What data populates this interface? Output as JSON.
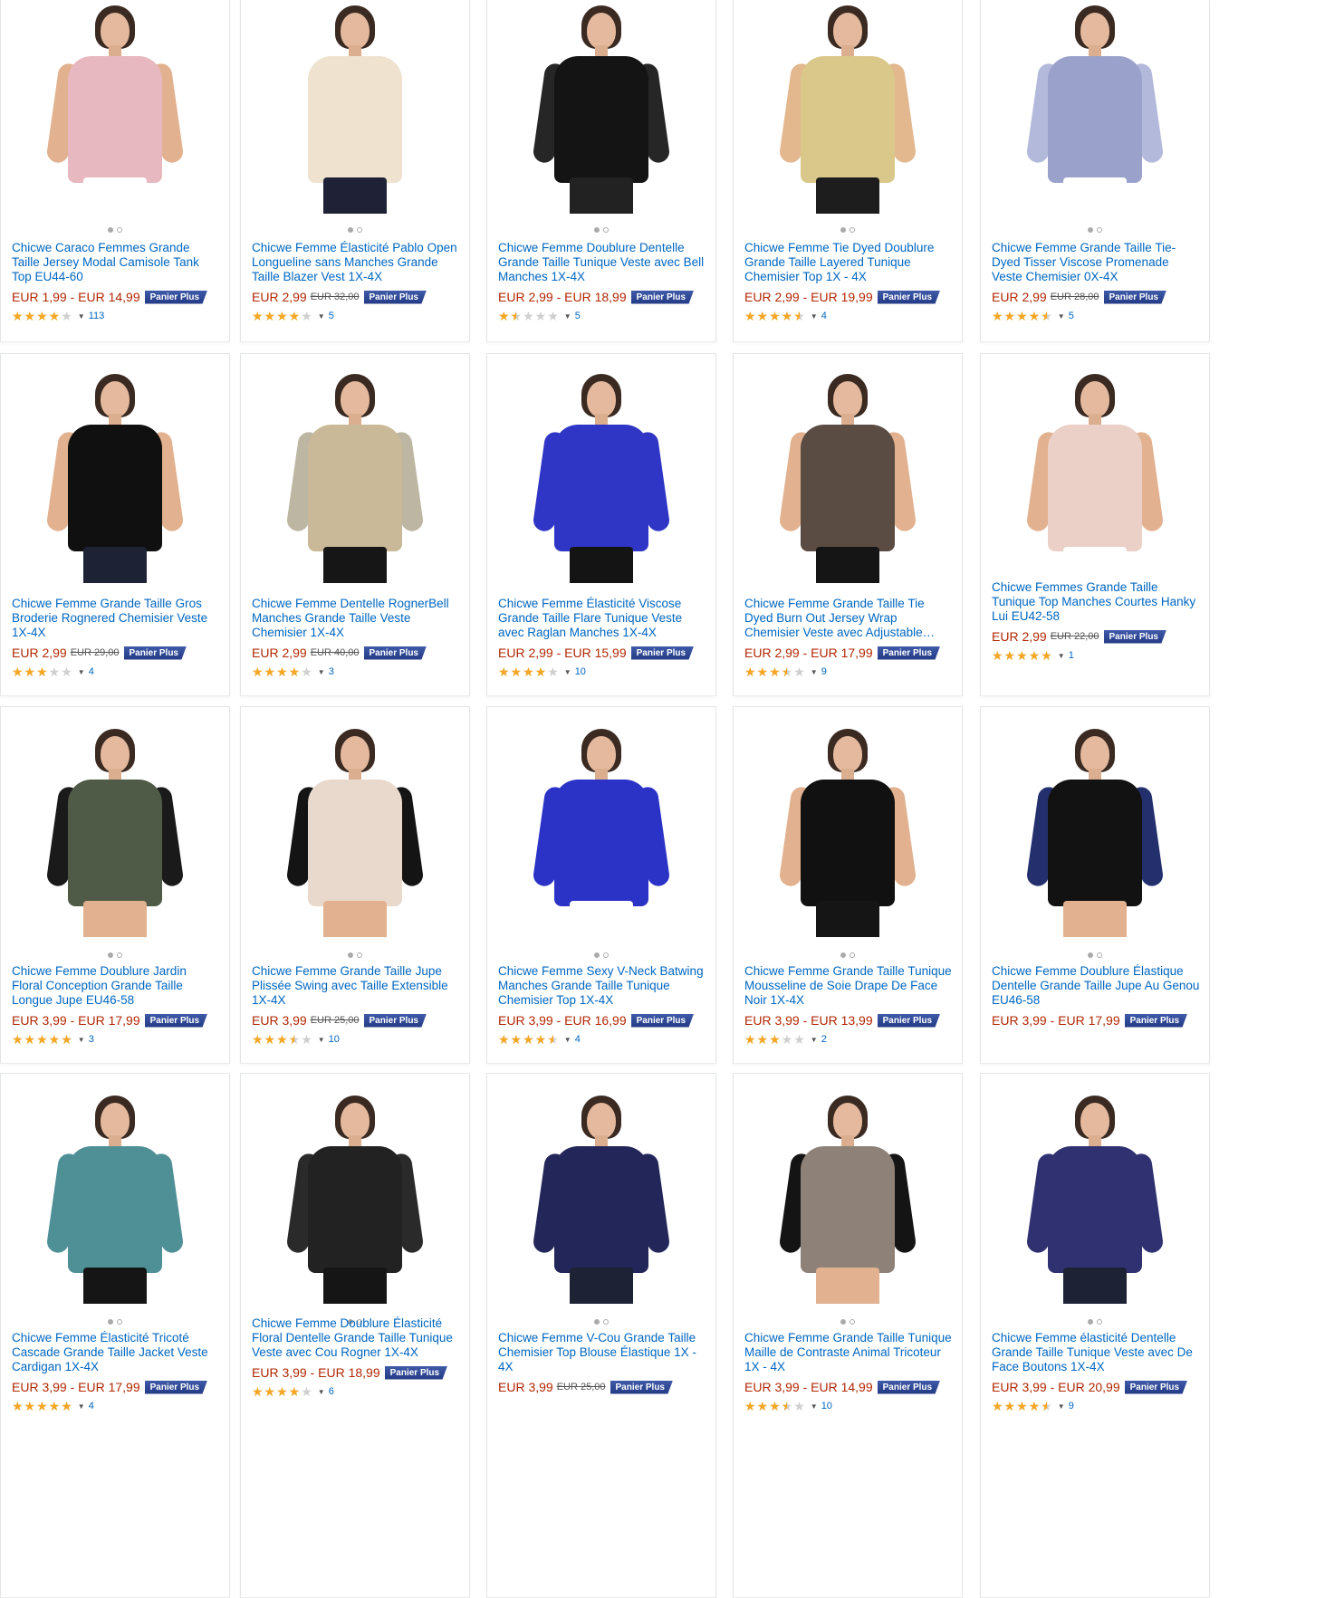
{
  "badge_label": "Panier Plus",
  "products": [
    {
      "title": "Chicwe Caraco Femmes Grande Taille Jersey Modal Camisole Tank Top EU44-60",
      "price": "EUR 1,99 - EUR 14,99",
      "old_price": "",
      "rating": 4.0,
      "reviews": "113",
      "top": "#e7b8bf",
      "sleeve": "#e2b18f",
      "legs": "#ffffff"
    },
    {
      "title": "Chicwe Femme Élasticité Pablo Open Longueline sans Manches Grande Taille Blazer Vest 1X-4X",
      "price": "EUR 2,99",
      "old_price": "EUR 32,00",
      "rating": 4.0,
      "reviews": "5",
      "top": "#efe2cf",
      "sleeve": "#ffffff",
      "legs": "#1f2236"
    },
    {
      "title": "Chicwe Femme Doublure Dentelle Grande Taille Tunique Veste avec Bell Manches 1X-4X",
      "price": "EUR 2,99 - EUR 18,99",
      "old_price": "",
      "rating": 1.5,
      "reviews": "5",
      "top": "#141414",
      "sleeve": "#262626",
      "legs": "#222222"
    },
    {
      "title": "Chicwe Femme Tie Dyed Doublure Grande Taille Layered Tunique Chemisier Top 1X - 4X",
      "price": "EUR 2,99 - EUR 19,99",
      "old_price": "",
      "rating": 4.5,
      "reviews": "4",
      "top": "#d9c88a",
      "sleeve": "#e3b88f",
      "legs": "#1d1d1d"
    },
    {
      "title": "Chicwe Femme Grande Taille Tie-Dyed Tisser Viscose Promenade Veste Chemisier 0X-4X",
      "price": "EUR 2,99",
      "old_price": "EUR 28,00",
      "rating": 4.5,
      "reviews": "5",
      "top": "#9aa2cc",
      "sleeve": "#b3b9da",
      "legs": "#ffffff"
    },
    {
      "title": "Chicwe Femme Grande Taille Gros Broderie Rognered Chemisier Veste 1X-4X",
      "price": "EUR 2,99",
      "old_price": "EUR 29,00",
      "rating": 3.0,
      "reviews": "4",
      "top": "#101010",
      "sleeve": "#e2b18f",
      "legs": "#1e2235"
    },
    {
      "title": "Chicwe Femme Dentelle RognerBell Manches Grande Taille Veste Chemisier 1X-4X",
      "price": "EUR 2,99",
      "old_price": "EUR 40,00",
      "rating": 4.0,
      "reviews": "3",
      "top": "#c9b998",
      "sleeve": "#bdb6a2",
      "legs": "#161616"
    },
    {
      "title": "Chicwe Femme Élasticité Viscose Grande Taille Flare Tunique Veste avec Raglan Manches 1X-4X",
      "price": "EUR 2,99 - EUR 15,99",
      "old_price": "",
      "rating": 4.0,
      "reviews": "10",
      "top": "#2f35c4",
      "sleeve": "#2f35c4",
      "legs": "#141414"
    },
    {
      "title": "Chicwe Femme Grande Taille Tie Dyed Burn Out Jersey Wrap Chemisier Veste avec Adjustable Waist Tie",
      "price": "EUR 2,99 - EUR 17,99",
      "old_price": "",
      "rating": 3.5,
      "reviews": "9",
      "top": "#5a4c42",
      "sleeve": "#e2b18f",
      "legs": "#151515"
    },
    {
      "title": "Chicwe Femmes Grande Taille Tunique Top Manches Courtes Hanky Lui EU42-58",
      "price": "EUR 2,99",
      "old_price": "EUR 22,00",
      "rating": 5.0,
      "reviews": "1",
      "top": "#ead0c6",
      "sleeve": "#e2b18f",
      "legs": "#ffffff"
    },
    {
      "title": "Chicwe Femme Doublure Jardin Floral Conception Grande Taille Longue Jupe EU46-58",
      "price": "EUR 3,99 - EUR 17,99",
      "old_price": "",
      "rating": 5.0,
      "reviews": "3",
      "top": "#4f5b46",
      "sleeve": "#1a1a1a",
      "legs": "#e2b18f"
    },
    {
      "title": "Chicwe Femme Grande Taille Jupe Plissée Swing avec Taille Extensible 1X-4X",
      "price": "EUR 3,99",
      "old_price": "EUR 25,00",
      "rating": 3.5,
      "reviews": "10",
      "top": "#e9d9cc",
      "sleeve": "#141414",
      "legs": "#e2b18f"
    },
    {
      "title": "Chicwe Femme Sexy V-Neck Batwing Manches Grande Taille Tunique Chemisier Top 1X-4X",
      "price": "EUR 3,99 - EUR 16,99",
      "old_price": "",
      "rating": 4.5,
      "reviews": "4",
      "top": "#2b33c7",
      "sleeve": "#2b33c7",
      "legs": "#ffffff"
    },
    {
      "title": "Chicwe Femme Grande Taille Tunique Mousseline de Soie Drape De Face Noir 1X-4X",
      "price": "EUR 3,99 - EUR 13,99",
      "old_price": "",
      "rating": 3.0,
      "reviews": "2",
      "top": "#111111",
      "sleeve": "#e2b18f",
      "legs": "#151515"
    },
    {
      "title": "Chicwe Femme Doublure Élastique Dentelle Grande Taille Jupe Au Genou EU46-58",
      "price": "EUR 3,99 - EUR 17,99",
      "old_price": "",
      "rating": null,
      "reviews": "",
      "top": "#121212",
      "sleeve": "#24306e",
      "legs": "#e2b18f"
    },
    {
      "title": "Chicwe Femme Élasticité Tricoté Cascade Grande Taille Jacket Veste Cardigan 1X-4X",
      "price": "EUR 3,99 - EUR 17,99",
      "old_price": "",
      "rating": 5.0,
      "reviews": "4",
      "top": "#4f8f96",
      "sleeve": "#4f8f96",
      "legs": "#151515"
    },
    {
      "title": "Chicwe Femme Doublure Élasticité Floral Dentelle Grande Taille Tunique Veste avec Cou Rogner 1X-4X",
      "price": "EUR 3,99 - EUR 18,99",
      "old_price": "",
      "rating": 4.0,
      "reviews": "6",
      "top": "#222222",
      "sleeve": "#2a2a2a",
      "legs": "#151515"
    },
    {
      "title": "Chicwe Femme V-Cou Grande Taille Chemisier Top Blouse Élastique 1X - 4X",
      "price": "EUR 3,99",
      "old_price": "EUR 25,00",
      "rating": null,
      "reviews": "",
      "top": "#232659",
      "sleeve": "#232659",
      "legs": "#1e2235"
    },
    {
      "title": "Chicwe Femme Grande Taille Tunique Maille de Contraste Animal Tricoteur 1X - 4X",
      "price": "EUR 3,99 - EUR 14,99",
      "old_price": "",
      "rating": 3.5,
      "reviews": "10",
      "top": "#8e8278",
      "sleeve": "#141414",
      "legs": "#e2b18f"
    },
    {
      "title": "Chicwe Femme élasticité Dentelle Grande Taille Tunique Veste avec De Face Boutons 1X-4X",
      "price": "EUR 3,99 - EUR 20,99",
      "old_price": "",
      "rating": 4.5,
      "reviews": "9",
      "top": "#2f3170",
      "sleeve": "#2f3170",
      "legs": "#1e2235"
    }
  ]
}
